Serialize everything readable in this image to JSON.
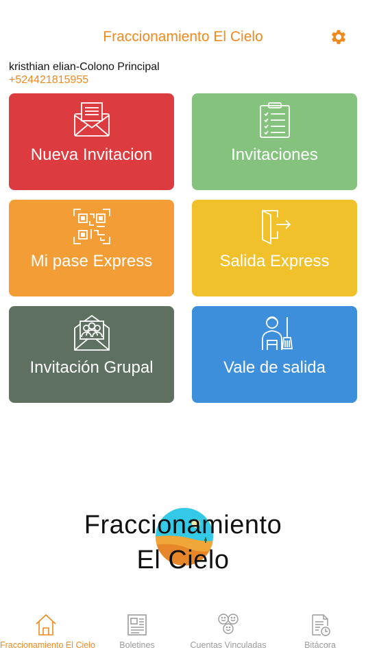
{
  "header": {
    "title": "Fraccionamiento El Cielo",
    "settings_icon": "gear-icon"
  },
  "user": {
    "name": "kristhian elian-Colono Principal",
    "phone": "+524421815955"
  },
  "tiles": [
    {
      "label": "Nueva Invitacion",
      "icon": "envelope-letter-icon",
      "color": "#dc3c3f"
    },
    {
      "label": "Invitaciones",
      "icon": "clipboard-checklist-icon",
      "color": "#84c27d"
    },
    {
      "label": "Mi pase Express",
      "icon": "qr-code-icon",
      "color": "#f29d36"
    },
    {
      "label": "Salida Express",
      "icon": "door-exit-icon",
      "color": "#f1c12c"
    },
    {
      "label": "Invitación Grupal",
      "icon": "group-envelope-icon",
      "color": "#5e7161"
    },
    {
      "label": "Vale de salida",
      "icon": "housekeeper-icon",
      "color": "#3e8fdb"
    }
  ],
  "logo": {
    "line1": "Fraccionamiento",
    "line2": "El Cielo"
  },
  "tabbar": [
    {
      "label": "Fraccionamiento El Cielo",
      "icon": "home-icon",
      "active": true
    },
    {
      "label": "Boletines",
      "icon": "newspaper-icon",
      "active": false
    },
    {
      "label": "Cuentas Vinculadas",
      "icon": "linked-faces-icon",
      "active": false
    },
    {
      "label": "Bitácora",
      "icon": "log-clock-icon",
      "active": false
    }
  ],
  "colors": {
    "accent": "#f0891e",
    "inactive": "#9a9a9a"
  }
}
